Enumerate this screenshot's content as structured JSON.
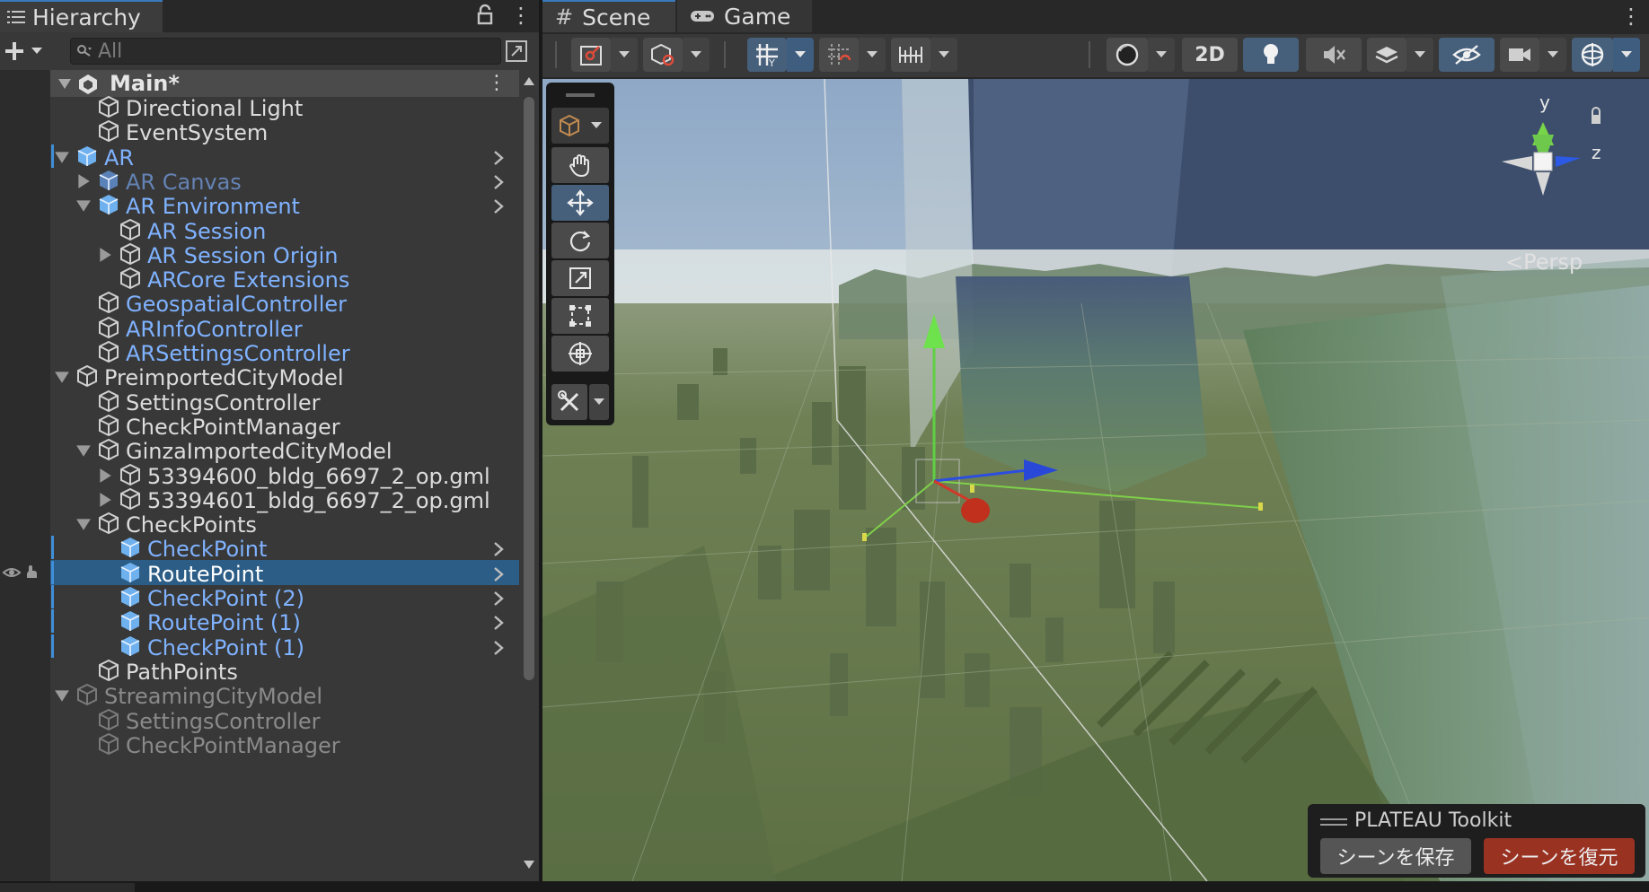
{
  "hierarchy": {
    "title": "Hierarchy",
    "search_placeholder": "All",
    "scene_name": "Main*",
    "items": [
      {
        "label": "Directional Light"
      },
      {
        "label": "EventSystem"
      },
      {
        "label": "AR"
      },
      {
        "label": "AR Canvas"
      },
      {
        "label": "AR Environment"
      },
      {
        "label": "AR Session"
      },
      {
        "label": "AR Session Origin"
      },
      {
        "label": "ARCore Extensions"
      },
      {
        "label": "GeospatialController"
      },
      {
        "label": "ARInfoController"
      },
      {
        "label": "ARSettingsController"
      },
      {
        "label": "PreimportedCityModel"
      },
      {
        "label": "SettingsController"
      },
      {
        "label": "CheckPointManager"
      },
      {
        "label": "GinzaImportedCityModel"
      },
      {
        "label": "53394600_bldg_6697_2_op.gml"
      },
      {
        "label": "53394601_bldg_6697_2_op.gml"
      },
      {
        "label": "CheckPoints"
      },
      {
        "label": "CheckPoint"
      },
      {
        "label": "RoutePoint"
      },
      {
        "label": "CheckPoint (2)"
      },
      {
        "label": "RoutePoint (1)"
      },
      {
        "label": "CheckPoint (1)"
      },
      {
        "label": "PathPoints"
      },
      {
        "label": "StreamingCityModel"
      },
      {
        "label": "SettingsController"
      },
      {
        "label": "CheckPointManager"
      }
    ]
  },
  "tabs": {
    "scene": "Scene",
    "game": "Game"
  },
  "toolbar": {
    "mode_2d": "2D"
  },
  "viewport": {
    "projection": "Persp",
    "axis_y": "y",
    "axis_z": "z"
  },
  "plateau": {
    "title": "PLATEAU Toolkit",
    "save_label": "シーンを保存",
    "restore_label": "シーンを復元"
  },
  "colors": {
    "selection": "#2c5d87",
    "prefab_text": "#7fb2ff",
    "accent_blue": "#3a79bb",
    "restore_button": "#9a3222",
    "axis_x": "#d03a2a",
    "axis_y": "#5fd044",
    "axis_z": "#2c4ee0"
  }
}
